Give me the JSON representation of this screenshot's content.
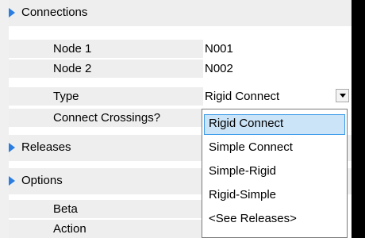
{
  "window": {
    "title": ""
  },
  "colors": {
    "accent": "#2a7de1",
    "category_bg": "#eeeeee",
    "selection_bg": "#cce4f7",
    "selection_border": "#3c9be8"
  },
  "categories": {
    "connections": {
      "label": "Connections",
      "icon": "expand-triangle-icon"
    },
    "releases": {
      "label": "Releases",
      "icon": "expand-triangle-icon"
    },
    "options": {
      "label": "Options",
      "icon": "expand-triangle-icon"
    }
  },
  "properties": {
    "node1": {
      "name": "Node 1",
      "value": "N001"
    },
    "node2": {
      "name": "Node 2",
      "value": "N002"
    },
    "type": {
      "name": "Type",
      "value": "Rigid Connect",
      "dropdown_icon": "chevron-down-icon"
    },
    "connect_crossings": {
      "name": "Connect Crossings?"
    },
    "beta": {
      "name": "Beta"
    },
    "action": {
      "name": "Action"
    }
  },
  "dropdown": {
    "selected": "Rigid Connect",
    "options": [
      "Rigid Connect",
      "Simple Connect",
      "Simple-Rigid",
      "Rigid-Simple",
      "<See Releases>"
    ]
  }
}
